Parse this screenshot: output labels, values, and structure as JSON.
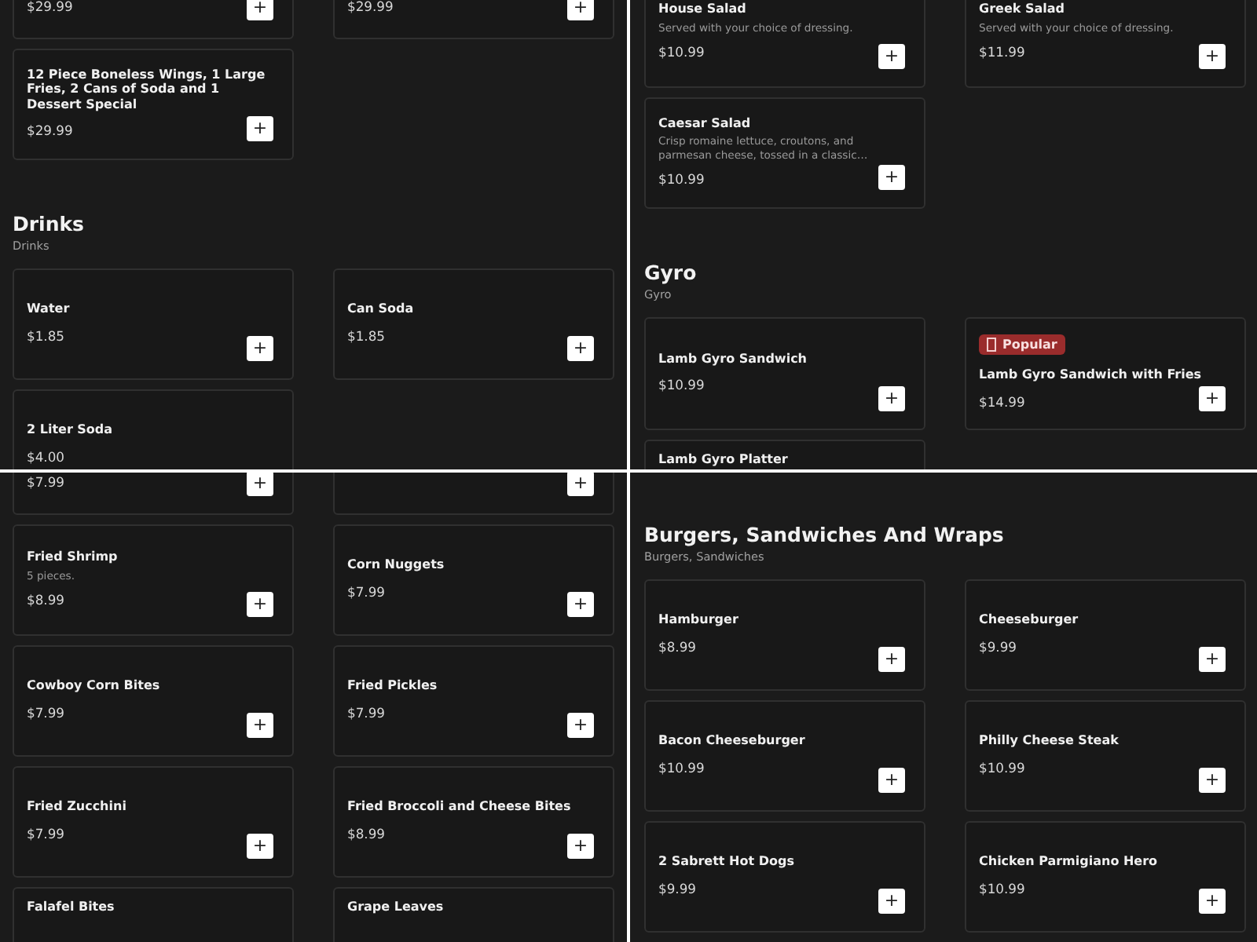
{
  "panels": [
    {
      "sections": [
        {
          "items": [
            {
              "price": "$29.99",
              "button": "+"
            },
            {
              "price": "$29.99",
              "button": "+"
            },
            {
              "name": "12 Piece Boneless Wings, 1 Large Fries, 2 Cans of Soda and 1 Dessert Special",
              "price": "$29.99",
              "button": "+"
            }
          ]
        },
        {
          "title": "Drinks",
          "subtitle": "Drinks",
          "items": [
            {
              "name": "Water",
              "price": "$1.85",
              "button": "+"
            },
            {
              "name": "Can Soda",
              "price": "$1.85",
              "button": "+"
            },
            {
              "name": "2 Liter Soda",
              "price": "$4.00"
            }
          ]
        }
      ]
    },
    {
      "sections": [
        {
          "items": [
            {
              "name": "House Salad",
              "description": "Served with your choice of dressing.",
              "price": "$10.99",
              "button": "+"
            },
            {
              "name": "Greek Salad",
              "description": "Served with your choice of dressing.",
              "price": "$11.99",
              "button": "+"
            },
            {
              "name": "Caesar Salad",
              "description": "Crisp romaine lettuce, croutons, and parmesan cheese, tossed in a classic…",
              "price": "$10.99",
              "button": "+"
            }
          ]
        },
        {
          "title": "Gyro",
          "subtitle": "Gyro",
          "items": [
            {
              "name": "Lamb Gyro Sandwich",
              "price": "$10.99",
              "button": "+"
            },
            {
              "badge": "Popular",
              "name": "Lamb Gyro Sandwich with Fries",
              "price": "$14.99",
              "button": "+"
            },
            {
              "name": "Lamb Gyro Platter"
            }
          ]
        }
      ]
    },
    {
      "sections": [
        {
          "items": [
            {
              "price": "$7.99",
              "button": "+"
            },
            {
              "button": "+"
            },
            {
              "name": "Fried Shrimp",
              "description": "5 pieces.",
              "price": "$8.99",
              "button": "+"
            },
            {
              "name": "Corn Nuggets",
              "price": "$7.99",
              "button": "+"
            },
            {
              "name": "Cowboy Corn Bites",
              "price": "$7.99",
              "button": "+"
            },
            {
              "name": "Fried Pickles",
              "price": "$7.99",
              "button": "+"
            },
            {
              "name": "Fried Zucchini",
              "price": "$7.99",
              "button": "+"
            },
            {
              "name": "Fried Broccoli and Cheese Bites",
              "price": "$8.99",
              "button": "+"
            },
            {
              "name": "Falafel Bites"
            },
            {
              "name": "Grape Leaves"
            }
          ]
        }
      ]
    },
    {
      "sections": [
        {
          "title": "Burgers, Sandwiches And Wraps",
          "subtitle": "Burgers, Sandwiches",
          "items": [
            {
              "name": "Hamburger",
              "price": "$8.99",
              "button": "+"
            },
            {
              "name": "Cheeseburger",
              "price": "$9.99",
              "button": "+"
            },
            {
              "name": "Bacon Cheeseburger",
              "price": "$10.99",
              "button": "+"
            },
            {
              "name": "Philly Cheese Steak",
              "price": "$10.99",
              "button": "+"
            },
            {
              "name": "2 Sabrett Hot Dogs",
              "price": "$9.99",
              "button": "+"
            },
            {
              "name": "Chicken Parmigiano Hero",
              "price": "$10.99",
              "button": "+"
            }
          ]
        }
      ]
    }
  ]
}
